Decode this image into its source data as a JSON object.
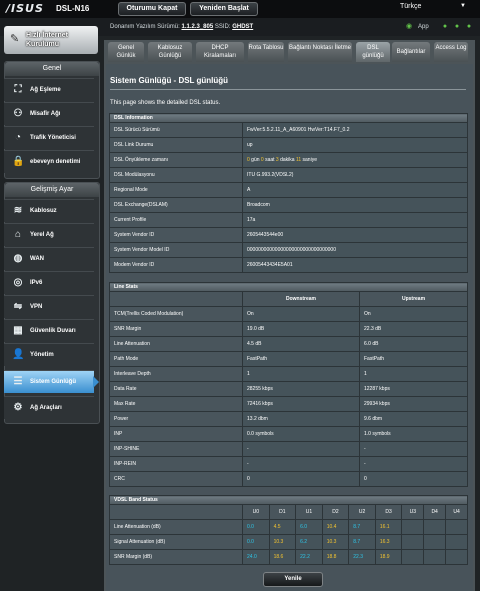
{
  "header": {
    "brand": "/ISUS",
    "model": "DSL-N16",
    "logout": "Oturumu Kapat",
    "reboot": "Yeniden Başlat",
    "language": "Türkçe"
  },
  "firmware": {
    "label": "Donanım Yazılım Sürümü:",
    "version": "1.1.2.3_805",
    "ssid_label": "SSID:",
    "ssid": "GHDST",
    "app_label": "App"
  },
  "sidebar": {
    "qis": "Hızlı İnternet Kurulumu",
    "general_header": "Genel",
    "general_items": [
      "Ağ Eşleme",
      "Misafir Ağı",
      "Trafik Yöneticisi",
      "ebeveyn denetimi"
    ],
    "advanced_header": "Gelişmiş Ayar",
    "advanced_items": [
      "Kablosuz",
      "Yerel Ağ",
      "WAN",
      "IPv6",
      "VPN",
      "Güvenlik Duvarı",
      "Yönetim",
      "Sistem Günlüğü",
      "Ağ Araçları"
    ]
  },
  "tabs": [
    "Genel Günlük",
    "Kablosuz Günlüğü",
    "DHCP Kiralamaları",
    "Rota Tablosu",
    "Bağlantı Noktası İletme",
    "DSL günlüğü",
    "Bağlantılar",
    "Access Log"
  ],
  "page": {
    "title": "Sistem Günlüğü - DSL günlüğü",
    "description": "This page shows the detailed DSL status."
  },
  "dsl_info": {
    "header": "DSL Information",
    "rows": [
      {
        "label": "DSL Sürücü Sürümü",
        "value": "FwVer:5.5.2.11_A_A60901 HwVer:T14.F7_0.2"
      },
      {
        "label": "DSL Link Durumu",
        "value": "up"
      },
      {
        "label": "DSL Önyükleme zamanı",
        "value": ""
      },
      {
        "label": "DSL Modülasyonu",
        "value": "ITU G.993.2(VDSL2)"
      },
      {
        "label": "Regional Mode",
        "value": "A"
      },
      {
        "label": "DSL Exchange(DSLAM)",
        "value": "Broadcom"
      },
      {
        "label": "Current Profile",
        "value": "17a"
      },
      {
        "label": "System Vendor ID",
        "value": "2605443544e00"
      },
      {
        "label": "System Vendor Model ID",
        "value": "00000000000000000000000000000000"
      },
      {
        "label": "Modem Vendor ID",
        "value": "26005443434E5A01"
      }
    ],
    "uptime": {
      "days": "0",
      "days_unit": "gün",
      "hours": "0",
      "hours_unit": "saat",
      "minutes": "3",
      "minutes_unit": "dakika",
      "seconds": "11",
      "seconds_unit": "saniye"
    }
  },
  "line_stats": {
    "header": "Line Stats",
    "col_down": "Downstream",
    "col_up": "Upstream",
    "rows": [
      {
        "label": "TCM(Trellis Coded Modulation)",
        "down": "On",
        "up": "On"
      },
      {
        "label": "SNR Margin",
        "down": "19.0 dB",
        "up": "22.3 dB"
      },
      {
        "label": "Line Attenuation",
        "down": "4.5 dB",
        "up": "6.0 dB"
      },
      {
        "label": "Path Mode",
        "down": "FastPath",
        "up": "FastPath"
      },
      {
        "label": "Interleave Depth",
        "down": "1",
        "up": "1"
      },
      {
        "label": "Data Rate",
        "down": "28255 kbps",
        "up": "12287 kbps"
      },
      {
        "label": "Max Rate",
        "down": "72416 kbps",
        "up": "29934 kbps"
      },
      {
        "label": "Power",
        "down": "13.2 dbm",
        "up": "9.6 dbm"
      },
      {
        "label": "INP",
        "down": "0.0 symbols",
        "up": "1.0 symbols"
      },
      {
        "label": "INP-SHINE",
        "down": "-",
        "up": "-"
      },
      {
        "label": "INP-REIN",
        "down": "-",
        "up": "-"
      },
      {
        "label": "CRC",
        "down": "0",
        "up": "0"
      }
    ]
  },
  "vdsl_band": {
    "header": "VDSL Band Status",
    "columns": [
      "U0",
      "D1",
      "U1",
      "D2",
      "U2",
      "D3",
      "U3",
      "D4",
      "U4"
    ],
    "rows": [
      {
        "label": "Line Attenuation (dB)",
        "values": [
          "0.0",
          "4.5",
          "6.0",
          "10.4",
          "8.7",
          "16.1",
          "",
          "",
          ""
        ]
      },
      {
        "label": "Signal Attenuation (dB)",
        "values": [
          "0.0",
          "10.3",
          "6.2",
          "10.3",
          "8.7",
          "16.3",
          "",
          "",
          ""
        ]
      },
      {
        "label": "SNR Margin (dB)",
        "values": [
          "24.0",
          "18.6",
          "22.2",
          "18.8",
          "22.3",
          "18.9",
          "",
          "",
          ""
        ]
      }
    ]
  },
  "apply": "Yenile",
  "colors": {
    "accent": "#3a8fd0",
    "upstream_cyan": "#2ec4e6",
    "downstream_yellow": "#f4c430"
  },
  "icons": [
    "wifi-icon",
    "usb-icon",
    "internet-status-icon",
    "printer-icon"
  ]
}
